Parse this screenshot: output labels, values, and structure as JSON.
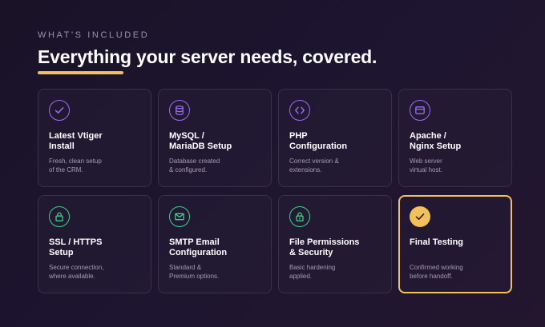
{
  "section": {
    "eyebrow": "WHAT'S INCLUDED",
    "headline": "Everything your server needs, covered."
  },
  "colors": {
    "accent_gold": "#f3c15a",
    "icon_purple": "#9b6cf0",
    "icon_green": "#3fcf86"
  },
  "cards": [
    {
      "icon": "check-circle-icon",
      "title": "Latest Vtiger\nInstall",
      "desc": "Fresh, clean setup\nof the CRM."
    },
    {
      "icon": "database-icon",
      "title": "MySQL /\nMariaDB Setup",
      "desc": "Database created\n& configured."
    },
    {
      "icon": "code-icon",
      "title": "PHP\nConfiguration",
      "desc": "Correct version &\nextensions."
    },
    {
      "icon": "browser-window-icon",
      "title": "Apache /\nNginx Setup",
      "desc": "Web server\nvirtual host."
    },
    {
      "icon": "lock-icon",
      "title": "SSL / HTTPS\nSetup",
      "desc": "Secure connection,\nwhere available."
    },
    {
      "icon": "mail-icon",
      "title": "SMTP Email\nConfiguration",
      "desc": "Standard &\nPremium options."
    },
    {
      "icon": "lock-icon",
      "title": "File Permissions\n& Security",
      "desc": "Basic hardening\napplied."
    },
    {
      "icon": "check-badge-icon",
      "title": "Final Testing",
      "desc": "Confirmed working\nbefore handoff."
    }
  ]
}
